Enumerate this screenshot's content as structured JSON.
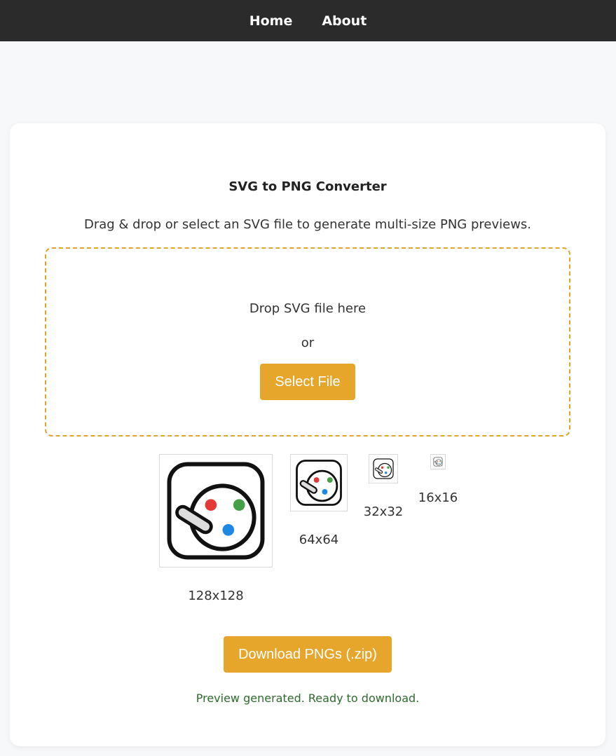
{
  "nav": {
    "items": [
      {
        "label": "Home"
      },
      {
        "label": "About"
      }
    ]
  },
  "converter": {
    "title": "SVG to PNG Converter",
    "subtitle": "Drag & drop or select an SVG file to generate multi-size PNG previews.",
    "dropzone": {
      "drop_text": "Drop SVG file here",
      "or_text": "or",
      "select_label": "Select File"
    },
    "previews": [
      {
        "label": "128x128",
        "icon": "palette-icon"
      },
      {
        "label": "64x64",
        "icon": "palette-icon"
      },
      {
        "label": "32x32",
        "icon": "palette-icon"
      },
      {
        "label": "16x16",
        "icon": "palette-icon"
      }
    ],
    "download_label": "Download PNGs (.zip)",
    "status": "Preview generated. Ready to download."
  },
  "colors": {
    "accent": "#e6a62c",
    "navbar": "#2b2b2b",
    "status": "#2e6b2e",
    "dot_red": "#e53935",
    "dot_green": "#43a047",
    "dot_blue": "#1e88e5"
  }
}
